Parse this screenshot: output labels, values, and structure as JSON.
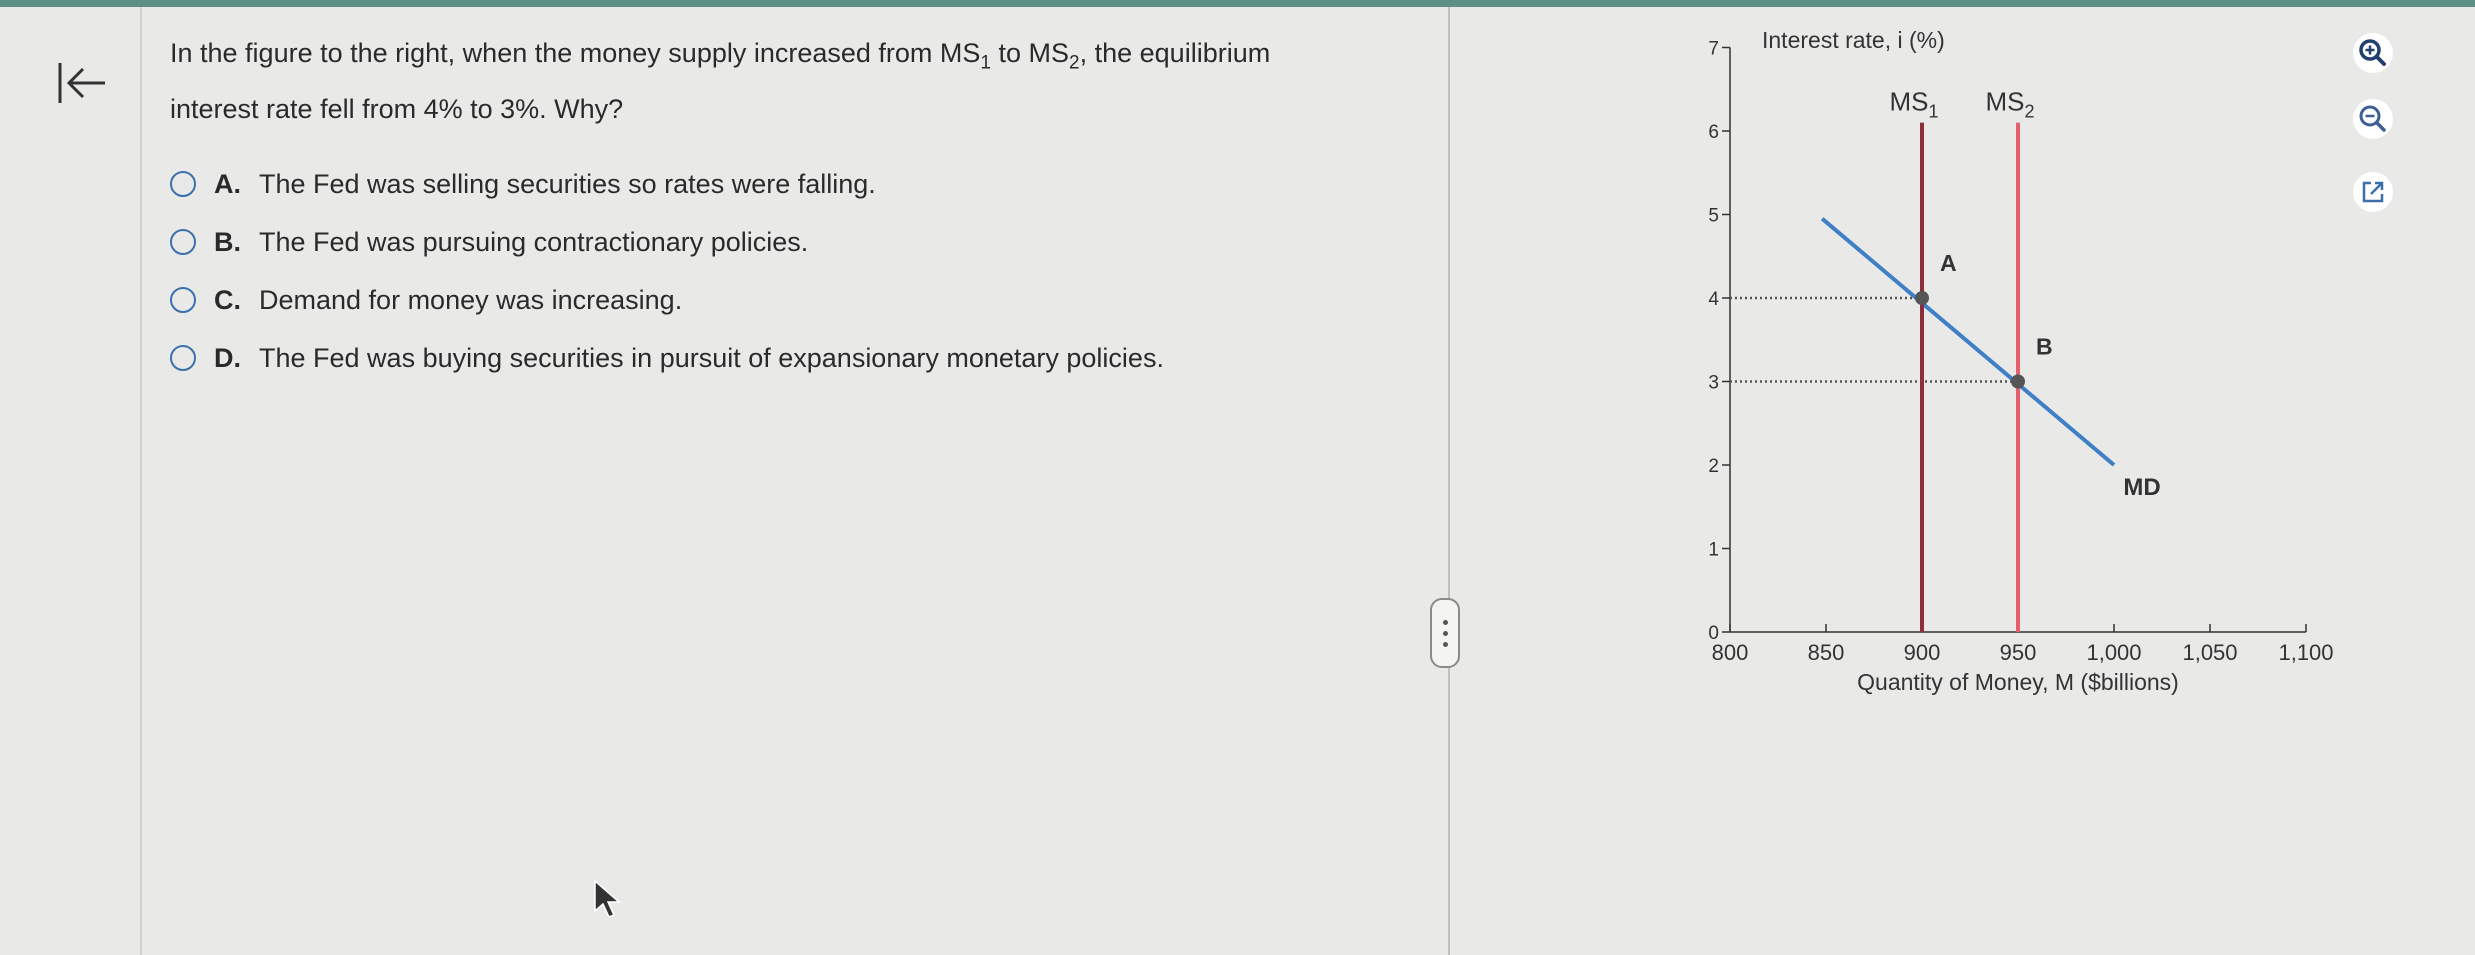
{
  "question": {
    "text_line1": "In the figure to the right, when the money supply increased from MS",
    "ms1_sub": "1",
    "text_to": " to MS",
    "ms2_sub": "2",
    "text_rest": ", the equilibrium",
    "text_line2": "interest rate fell from 4% to 3%. Why?"
  },
  "options": [
    {
      "letter": "A.",
      "label": "The Fed was selling securities so rates were falling."
    },
    {
      "letter": "B.",
      "label": "The Fed was pursuing contractionary policies."
    },
    {
      "letter": "C.",
      "label": "Demand for money was increasing."
    },
    {
      "letter": "D.",
      "label": "The Fed was buying securities in pursuit of  expansionary monetary policies."
    }
  ],
  "chart_data": {
    "type": "line",
    "ylabel": "Interest rate, i (%)",
    "xlabel": "Quantity of Money, M ($billions)",
    "xlim": [
      800,
      1100
    ],
    "ylim": [
      0,
      7
    ],
    "x_ticks": [
      "800",
      "850",
      "900",
      "950",
      "1,000",
      "1,050",
      "1,100"
    ],
    "x_tick_values": [
      800,
      850,
      900,
      950,
      1000,
      1050,
      1100
    ],
    "y_ticks": [
      "0",
      "1",
      "2",
      "3",
      "4",
      "5",
      "6",
      "7"
    ],
    "y_tick_values": [
      0,
      1,
      2,
      3,
      4,
      5,
      6,
      7
    ],
    "series": [
      {
        "name": "MD",
        "x": [
          848,
          1000
        ],
        "y": [
          4.95,
          2.0
        ],
        "color": "#3f7fc6"
      },
      {
        "name": "MS",
        "sub": "1",
        "x": [
          900,
          900
        ],
        "y": [
          0,
          6.1
        ],
        "color": "#8c2f3a"
      },
      {
        "name": "MS",
        "sub": "2",
        "x": [
          950,
          950
        ],
        "y": [
          0,
          6.1
        ],
        "color": "#e3616f"
      }
    ],
    "points": [
      {
        "label": "A",
        "x": 900,
        "y": 4
      },
      {
        "label": "B",
        "x": 950,
        "y": 3
      }
    ],
    "reference_lines": [
      {
        "y": 4,
        "x_end": 900
      },
      {
        "y": 3,
        "x_end": 950
      }
    ],
    "grid": false
  },
  "colors": {
    "accent": "#3c6fae",
    "ms1": "#8c2f3a",
    "ms2": "#e3616f",
    "md": "#3f7fc6",
    "topbar": "#5e8f86"
  },
  "icons": {
    "back": "collapse-left-icon",
    "zoom_in": "zoom-in-icon",
    "zoom_out": "zoom-out-icon",
    "popout": "external-link-icon"
  }
}
